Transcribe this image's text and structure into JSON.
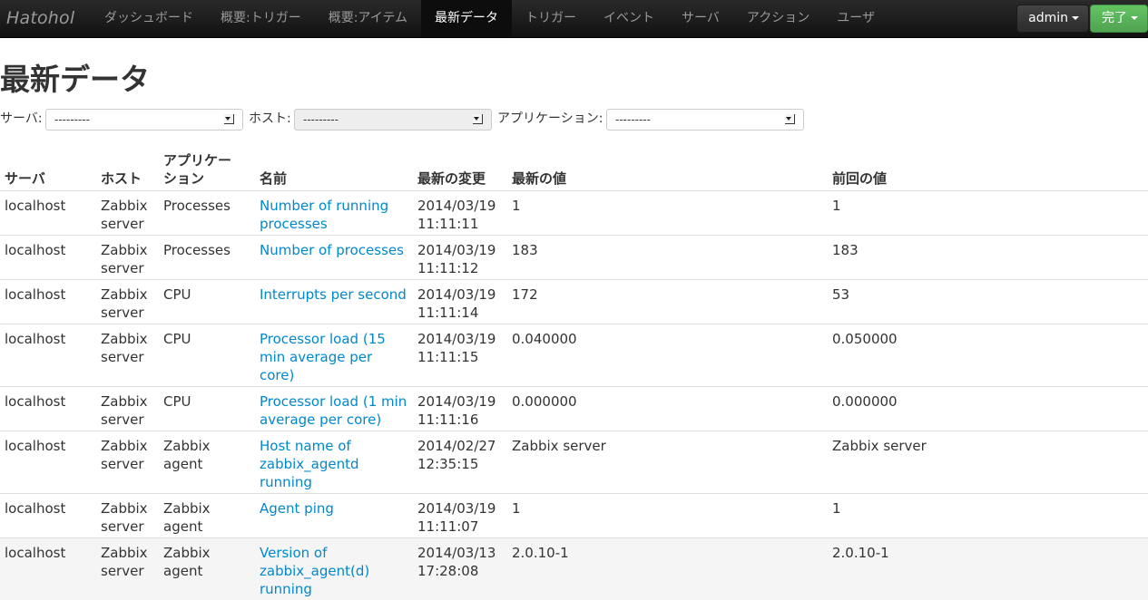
{
  "navbar": {
    "brand": "Hatohol",
    "items": [
      {
        "label": "ダッシュボード",
        "active": false
      },
      {
        "label": "概要:トリガー",
        "active": false
      },
      {
        "label": "概要:アイテム",
        "active": false
      },
      {
        "label": "最新データ",
        "active": true
      },
      {
        "label": "トリガー",
        "active": false
      },
      {
        "label": "イベント",
        "active": false
      },
      {
        "label": "サーバ",
        "active": false
      },
      {
        "label": "アクション",
        "active": false
      },
      {
        "label": "ユーザ",
        "active": false
      }
    ],
    "user_menu": "admin",
    "done_menu": "完了"
  },
  "page": {
    "title": "最新データ"
  },
  "filters": {
    "server": {
      "label": "サーバ:",
      "value": "---------"
    },
    "host": {
      "label": "ホスト:",
      "value": "---------"
    },
    "application": {
      "label": "アプリケーション:",
      "value": "---------"
    }
  },
  "table": {
    "headers": {
      "server": "サーバ",
      "host": "ホスト",
      "application": "アプリケー\nション",
      "name": "名前",
      "last_change": "最新の変更",
      "last_value": "最新の値",
      "prev_value": "前回の値"
    },
    "rows": [
      {
        "server": "localhost",
        "host": "Zabbix server",
        "application": "Processes",
        "name": "Number of running processes",
        "last_change": "2014/03/19 11:11:11",
        "last_value": "1",
        "prev_value": "1"
      },
      {
        "server": "localhost",
        "host": "Zabbix server",
        "application": "Processes",
        "name": "Number of processes",
        "last_change": "2014/03/19 11:11:12",
        "last_value": "183",
        "prev_value": "183"
      },
      {
        "server": "localhost",
        "host": "Zabbix server",
        "application": "CPU",
        "name": "Interrupts per second",
        "last_change": "2014/03/19 11:11:14",
        "last_value": "172",
        "prev_value": "53"
      },
      {
        "server": "localhost",
        "host": "Zabbix server",
        "application": "CPU",
        "name": "Processor load (15 min average per core)",
        "last_change": "2014/03/19 11:11:15",
        "last_value": "0.040000",
        "prev_value": "0.050000"
      },
      {
        "server": "localhost",
        "host": "Zabbix server",
        "application": "CPU",
        "name": "Processor load (1 min average per core)",
        "last_change": "2014/03/19 11:11:16",
        "last_value": "0.000000",
        "prev_value": "0.000000"
      },
      {
        "server": "localhost",
        "host": "Zabbix server",
        "application": "Zabbix agent",
        "name": "Host name of zabbix_agentd running",
        "last_change": "2014/02/27 12:35:15",
        "last_value": "Zabbix server",
        "prev_value": "Zabbix server"
      },
      {
        "server": "localhost",
        "host": "Zabbix server",
        "application": "Zabbix agent",
        "name": "Agent ping",
        "last_change": "2014/03/19 11:11:07",
        "last_value": "1",
        "prev_value": "1"
      },
      {
        "server": "localhost",
        "host": "Zabbix server",
        "application": "Zabbix agent",
        "name": "Version of zabbix_agent(d) running",
        "last_change": "2014/03/13 17:28:08",
        "last_value": "2.0.10-1",
        "prev_value": "2.0.10-1"
      }
    ]
  },
  "colors": {
    "link": "#0088cc",
    "navbar_bg": "#1b1b1b",
    "done_button": "#5bb75b"
  }
}
